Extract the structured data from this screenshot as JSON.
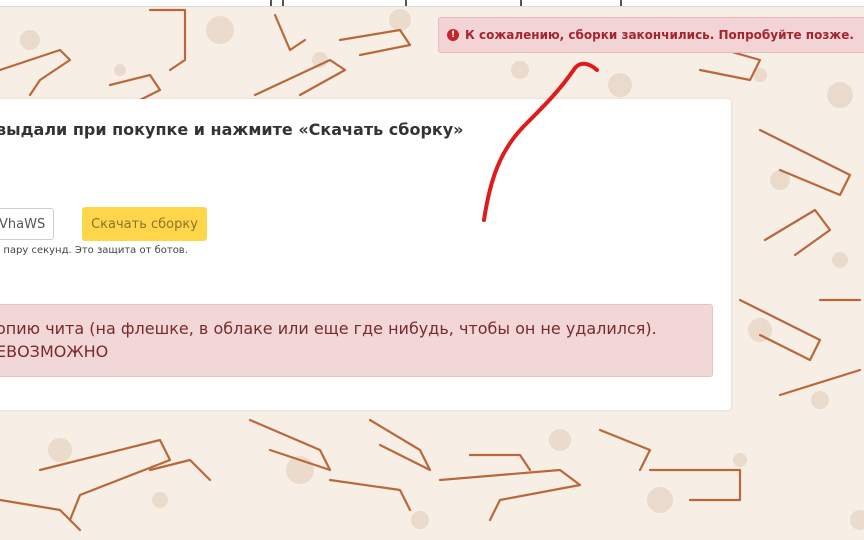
{
  "notification": {
    "icon": "exclamation-circle-icon",
    "message": "К сожалению, сборки закончились. Попробуйте позже."
  },
  "main": {
    "heading": "выдали при покупке и нажмите «Скачать сборку»",
    "code_input_value": "VhaWS",
    "download_button_label": "Скачать сборку",
    "bot_protection_note": "е пару секунд. Это защита от ботов."
  },
  "warning": {
    "line1": "опию чита (на флешке, в облаке или еще где нибудь, чтобы он не удалился).",
    "line2": "ЕВОЗМОЖНО"
  },
  "colors": {
    "accent_button": "#ffd54a",
    "alert_background": "#f2d7d9",
    "alert_text": "#a4262c",
    "annotation_stroke": "#e01b1b",
    "background_pattern": "#b9683a"
  }
}
